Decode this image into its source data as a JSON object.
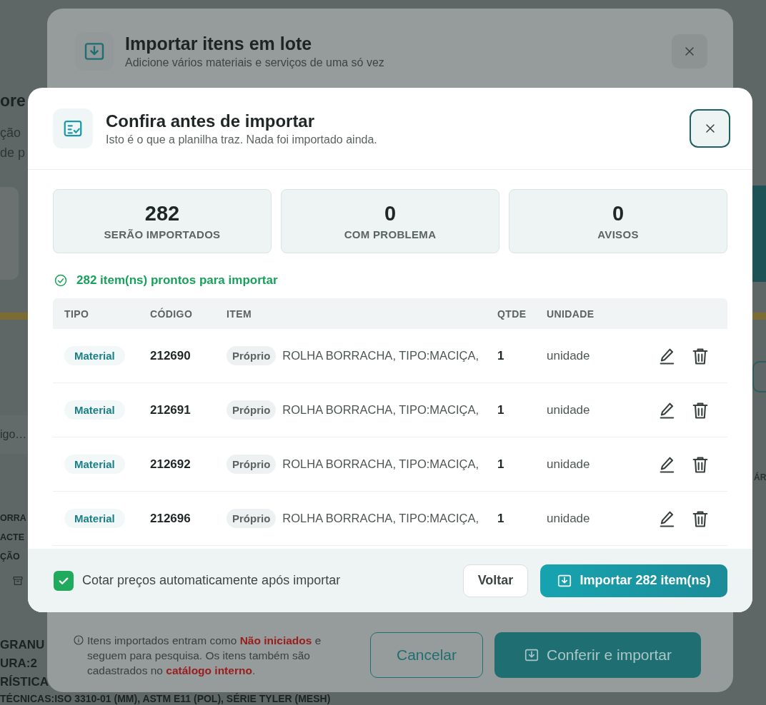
{
  "background_page": {
    "title": "ore",
    "description_lines": [
      "ção",
      "de p"
    ],
    "search": {
      "placeholder": "igo…"
    },
    "item_name_lines": [
      "ORRA",
      "ACTE",
      "ÇÃO"
    ],
    "detail_lines": [
      "GRANU",
      "URA:2",
      "RÍSTICA",
      "TÉCNICAS:ISO 3310-01 (MM), ASTM E11 (POL), SÉRIE TYLER (MESH)"
    ],
    "right_column_header": "ÁR"
  },
  "import_dialog": {
    "title": "Importar itens em lote",
    "subtitle": "Adicione vários materiais e serviços de uma só vez",
    "footer_note": "Itens importados entram como **Não iniciados** e seguem para pesquisa. Os itens também são cadastrados no **catálogo interno**.",
    "buttons": [
      {
        "label": "Cancelar",
        "kind": "secondary"
      },
      {
        "label": "Conferir e importar",
        "kind": "primary"
      }
    ]
  },
  "review_dialog": {
    "title": "Confira antes de importar",
    "subtitle": "Isto é o que a planilha traz. Nada foi importado ainda.",
    "stats": [
      {
        "value": "282",
        "label": "SERÃO IMPORTADOS"
      },
      {
        "value": "0",
        "label": "COM PROBLEMA"
      },
      {
        "value": "0",
        "label": "AVISOS"
      }
    ],
    "status": "282 item(ns) prontos para importar",
    "table": {
      "columns": [
        "TIPO",
        "CÓDIGO",
        "ITEM",
        "QTDE",
        "UNIDADE"
      ],
      "rows": [
        {
          "type": "Material",
          "code": "212690",
          "source": "Próprio",
          "item": "ROLHA BORRACHA, TIPO:MACIÇA,",
          "qty": "1",
          "unit": "unidade"
        },
        {
          "type": "Material",
          "code": "212691",
          "source": "Próprio",
          "item": "ROLHA BORRACHA, TIPO:MACIÇA,",
          "qty": "1",
          "unit": "unidade"
        },
        {
          "type": "Material",
          "code": "212692",
          "source": "Próprio",
          "item": "ROLHA BORRACHA, TIPO:MACIÇA,",
          "qty": "1",
          "unit": "unidade"
        },
        {
          "type": "Material",
          "code": "212696",
          "source": "Próprio",
          "item": "ROLHA BORRACHA, TIPO:MACIÇA,",
          "qty": "1",
          "unit": "unidade"
        }
      ]
    },
    "auto_quote": {
      "label": "Cotar preços automaticamente após importar",
      "checked": true
    },
    "buttons": [
      {
        "label": "Voltar",
        "kind": "secondary"
      },
      {
        "label": "Importar 282 item(ns)",
        "kind": "primary"
      }
    ]
  }
}
